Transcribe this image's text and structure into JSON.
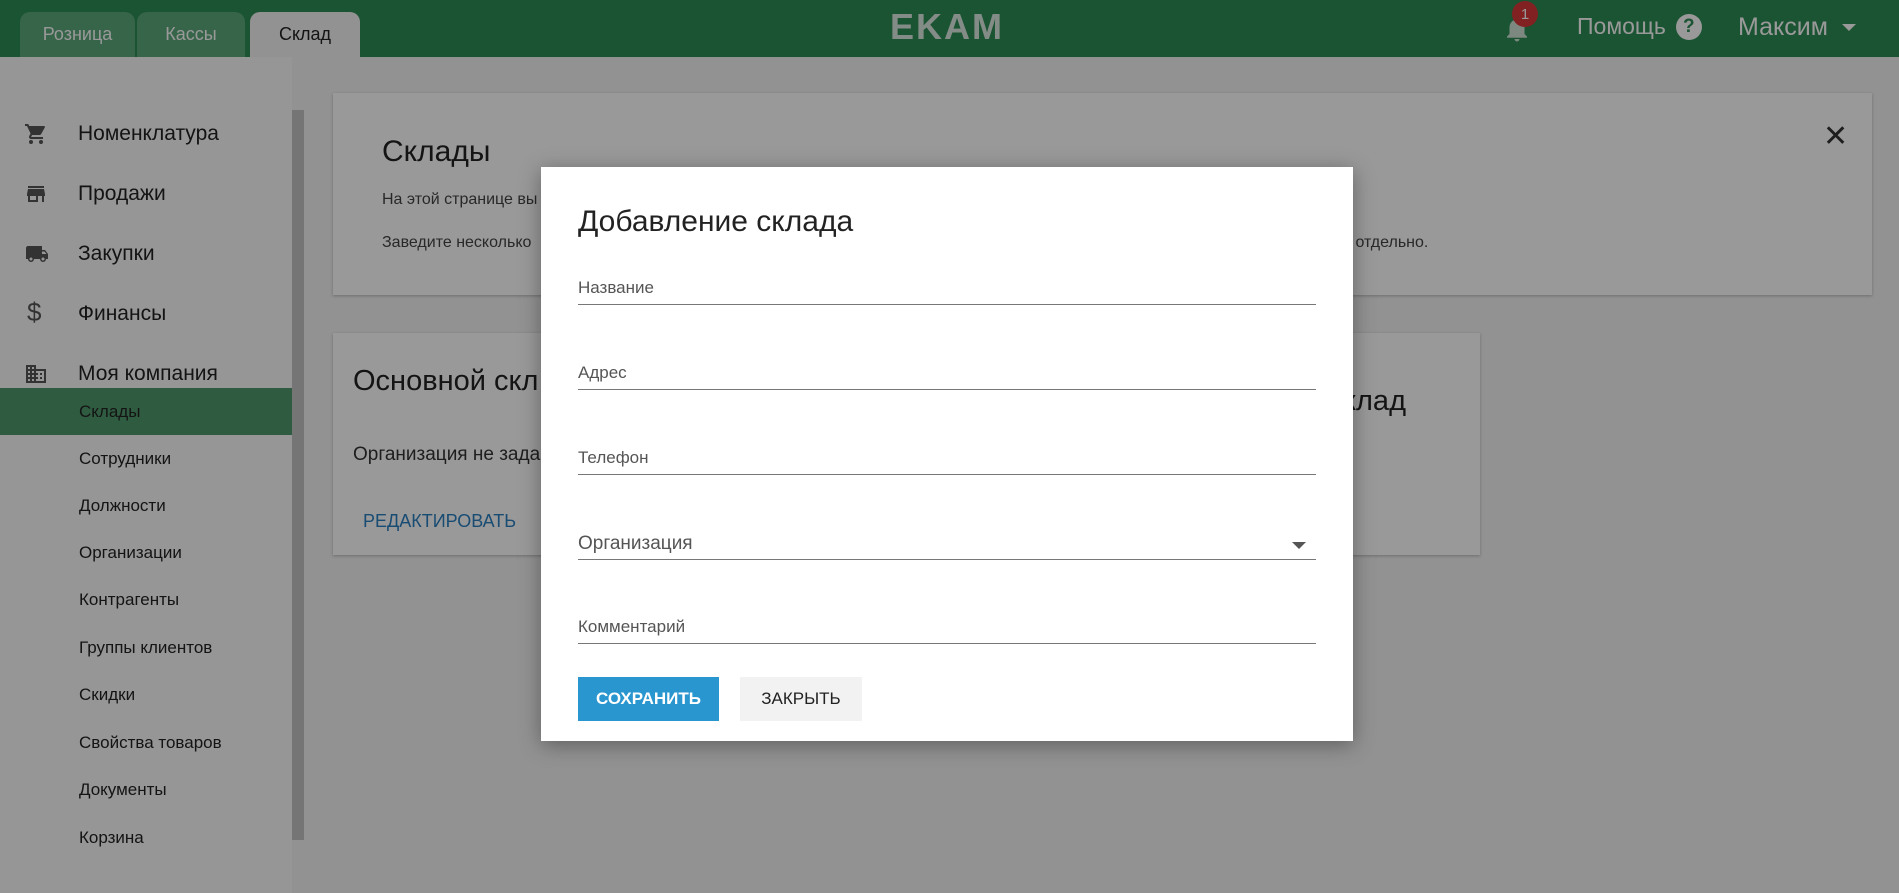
{
  "header": {
    "tabs": [
      {
        "label": "Розница"
      },
      {
        "label": "Кассы"
      },
      {
        "label": "Склад"
      }
    ],
    "logo": "EKAM",
    "notifications_count": "1",
    "help_label": "Помощь",
    "help_icon_text": "?",
    "user_name": "Максим",
    "accent_color": "#2e8c55"
  },
  "sidebar": {
    "main_items": [
      {
        "label": "Номенклатура",
        "icon": "cart-icon"
      },
      {
        "label": "Продажи",
        "icon": "store-icon"
      },
      {
        "label": "Закупки",
        "icon": "truck-icon"
      },
      {
        "label": "Финансы",
        "icon": "dollar-icon"
      },
      {
        "label": "Моя компания",
        "icon": "building-icon"
      }
    ],
    "sub_items": [
      {
        "label": "Склады",
        "active": true
      },
      {
        "label": "Сотрудники"
      },
      {
        "label": "Должности"
      },
      {
        "label": "Организации"
      },
      {
        "label": "Контрагенты"
      },
      {
        "label": "Группы клиентов"
      },
      {
        "label": "Скидки"
      },
      {
        "label": "Свойства товаров"
      },
      {
        "label": "Документы"
      },
      {
        "label": "Корзина"
      }
    ]
  },
  "info_card": {
    "title": "Склады",
    "line1": "На этой странице вы",
    "line2": "Заведите несколько",
    "line2_tail": "х отдельно."
  },
  "warehouse_card": {
    "title": "Основной скл",
    "organization_text": "Организация не зада",
    "edit_label": "РЕДАКТИРОВАТЬ",
    "right_title": "клад"
  },
  "modal": {
    "title": "Добавление склада",
    "fields": {
      "name": "Название",
      "address": "Адрес",
      "phone": "Телефон",
      "organization": "Организация",
      "comment": "Комментарий"
    },
    "save_label": "СОХРАНИТЬ",
    "close_label": "ЗАКРЫТЬ"
  }
}
